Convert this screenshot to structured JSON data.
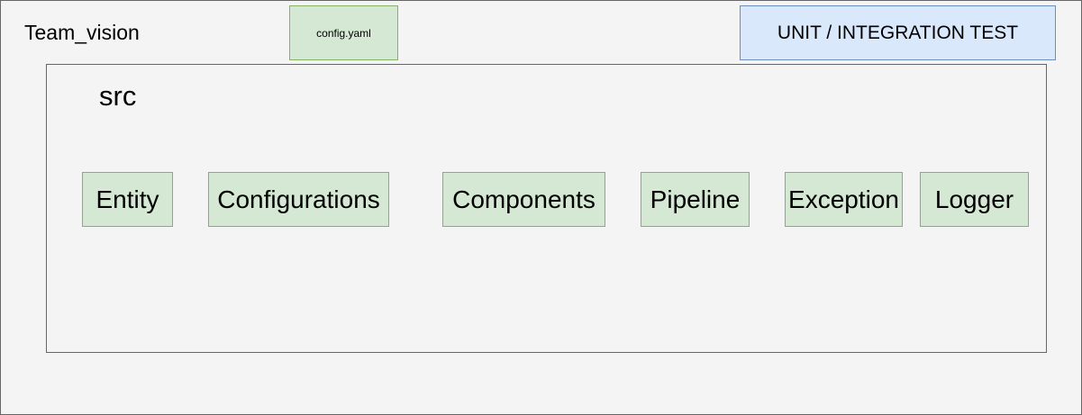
{
  "project": {
    "title": "Team_vision"
  },
  "config_file": {
    "label": "config.yaml"
  },
  "testing": {
    "label": "UNIT / INTEGRATION TEST"
  },
  "src": {
    "title": "src",
    "modules": [
      {
        "label": "Entity"
      },
      {
        "label": "Configurations"
      },
      {
        "label": "Components"
      },
      {
        "label": "Pipeline"
      },
      {
        "label": "Exception"
      },
      {
        "label": "Logger"
      }
    ]
  },
  "colors": {
    "module_fill": "#d5e8d4",
    "module_border": "#82b366",
    "test_fill": "#dae8fc",
    "test_border": "#6c8ebf",
    "canvas_bg": "#f4f4f4"
  }
}
